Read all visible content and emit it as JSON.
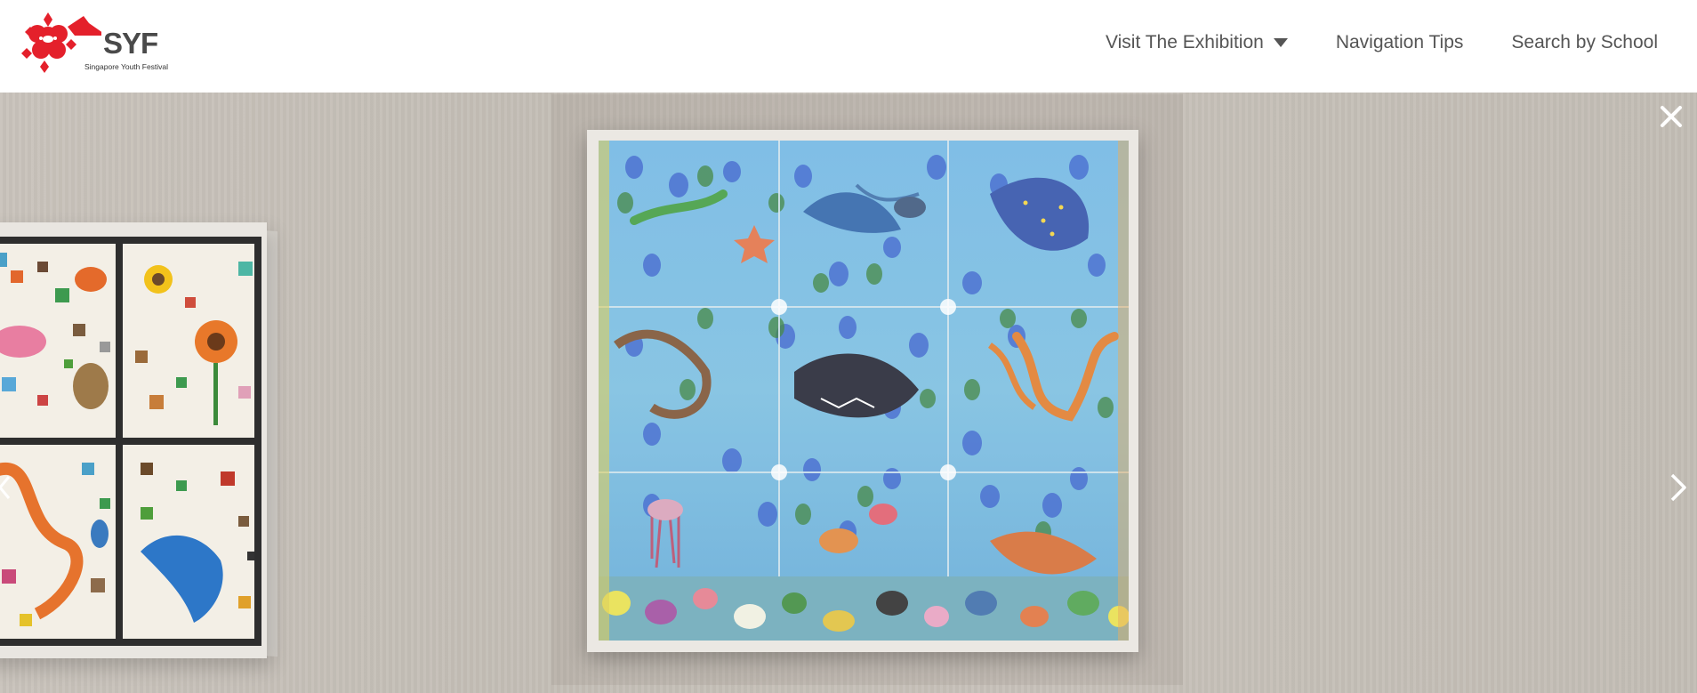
{
  "logo": {
    "text": "SYF",
    "subtitle": "Singapore Youth Festival",
    "color": "#e4202b"
  },
  "nav": {
    "items": [
      {
        "label": "Visit The Exhibition",
        "has_dropdown": true
      },
      {
        "label": "Navigation Tips",
        "has_dropdown": false
      },
      {
        "label": "Search by School",
        "has_dropdown": false
      }
    ]
  },
  "viewer": {
    "close_icon": "close-icon",
    "next_icon": "chevron-right-icon",
    "prev_icon": "chevron-left-icon",
    "wall_color": "#c6c0b8"
  }
}
